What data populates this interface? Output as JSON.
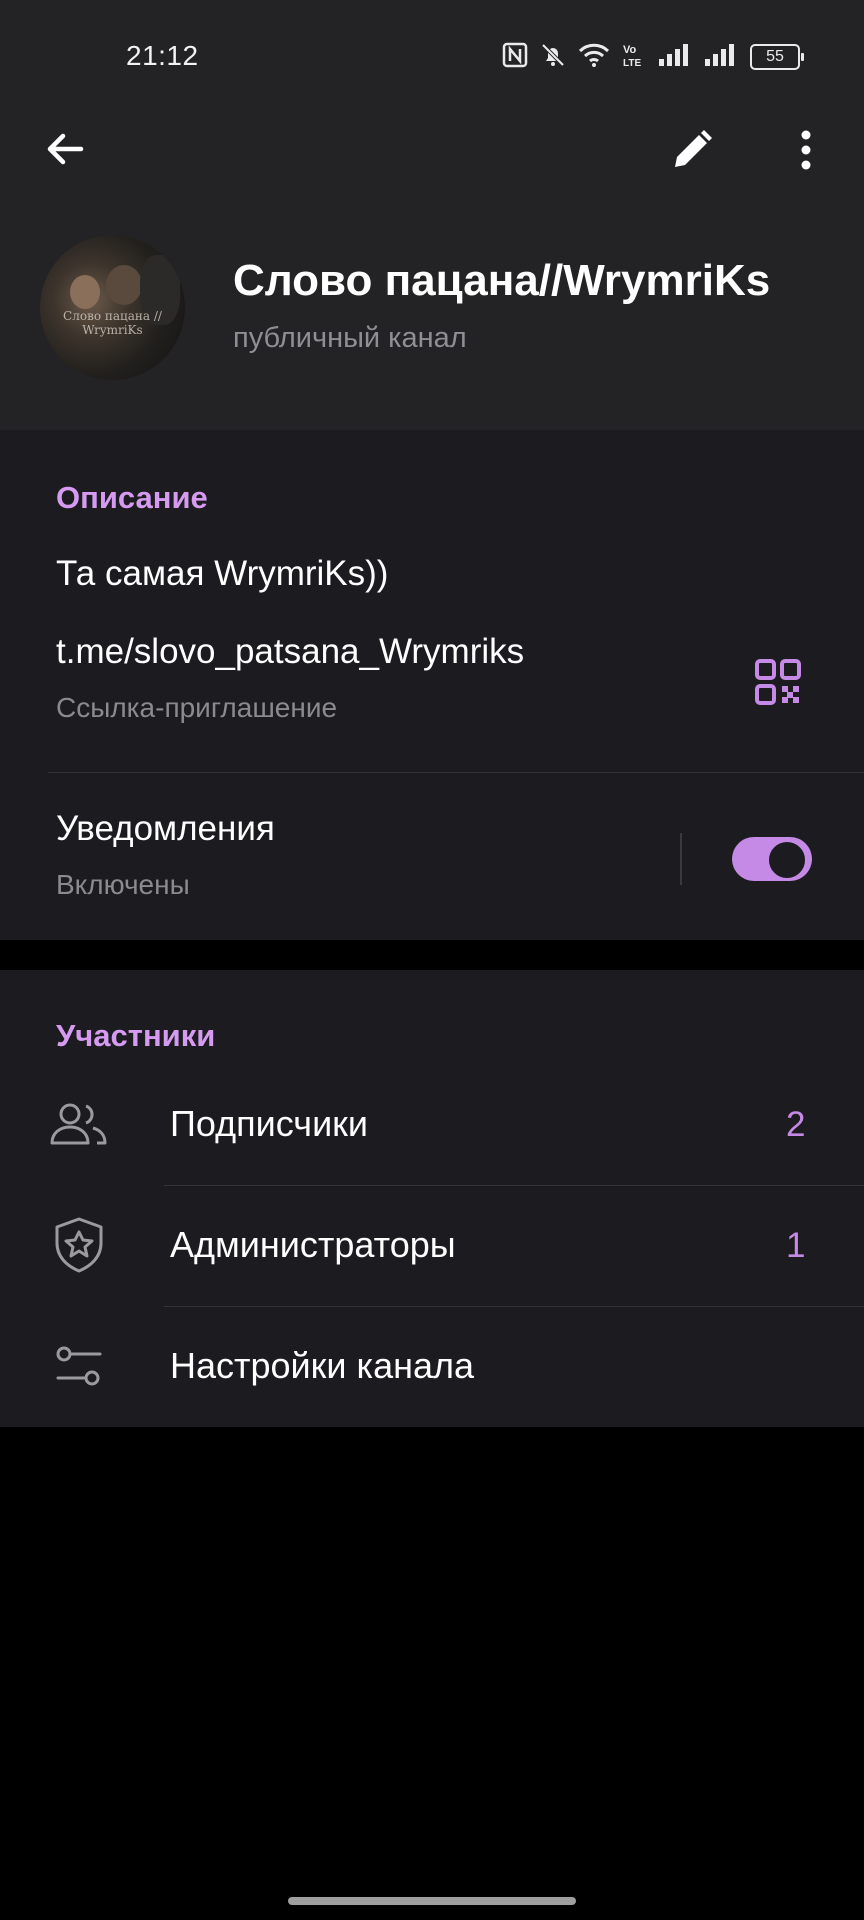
{
  "status_bar": {
    "time": "21:12",
    "battery": "55",
    "icons": [
      "nfc-icon",
      "bell-off-icon",
      "wifi-icon",
      "volte-icon",
      "signal-icon",
      "signal-icon",
      "battery-icon"
    ]
  },
  "toolbar": {
    "back_icon": "arrow-left-icon",
    "edit_icon": "pencil-icon",
    "menu_icon": "more-vertical-icon"
  },
  "channel": {
    "name": "Слово пацана//WrymriKs",
    "type": "публичный канал",
    "avatar_watermark": "Слово пацана // WrymriKs"
  },
  "info": {
    "header": "Описание",
    "description": "Та самая WrymriKs))",
    "link": "t.me/slovo_patsana_Wrymriks",
    "link_caption": "Ссылка-приглашение",
    "qr_icon": "qr-code-icon",
    "notifications_label": "Уведомления",
    "notifications_status": "Включены",
    "notifications_enabled": true
  },
  "members": {
    "header": "Участники",
    "items": [
      {
        "label": "Подписчики",
        "count": "2",
        "icon": "users-icon"
      },
      {
        "label": "Администраторы",
        "count": "1",
        "icon": "shield-star-icon"
      },
      {
        "label": "Настройки канала",
        "count": "",
        "icon": "sliders-icon"
      }
    ]
  },
  "colors": {
    "accent": "#c58ae5",
    "header_bg": "#232325",
    "section_bg": "#1c1b1f",
    "page_bg": "#000000"
  }
}
